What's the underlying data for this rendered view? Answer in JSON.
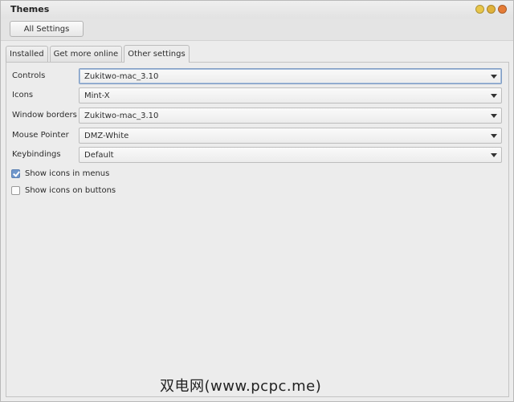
{
  "window": {
    "title": "Themes",
    "buttons": {
      "minimize_color": "#e8c64a",
      "maximize_color": "#e0b23b",
      "close_color": "#e57c36"
    }
  },
  "toolbar": {
    "all_settings_label": "All Settings"
  },
  "tabs": [
    {
      "label": "Installed",
      "active": false
    },
    {
      "label": "Get more online",
      "active": false
    },
    {
      "label": "Other settings",
      "active": true
    }
  ],
  "settings": [
    {
      "label": "Controls",
      "value": "Zukitwo-mac_3.10"
    },
    {
      "label": "Icons",
      "value": "Mint-X"
    },
    {
      "label": "Window borders",
      "value": "Zukitwo-mac_3.10"
    },
    {
      "label": "Mouse Pointer",
      "value": "DMZ-White"
    },
    {
      "label": "Keybindings",
      "value": "Default"
    }
  ],
  "checkboxes": [
    {
      "label": "Show icons in menus",
      "checked": true
    },
    {
      "label": "Show icons on buttons",
      "checked": false
    }
  ],
  "watermark": "双电网(www.pcpc.me)",
  "colors": {
    "accent": "#6f97cc",
    "focus_border": "#7e9cc4"
  }
}
